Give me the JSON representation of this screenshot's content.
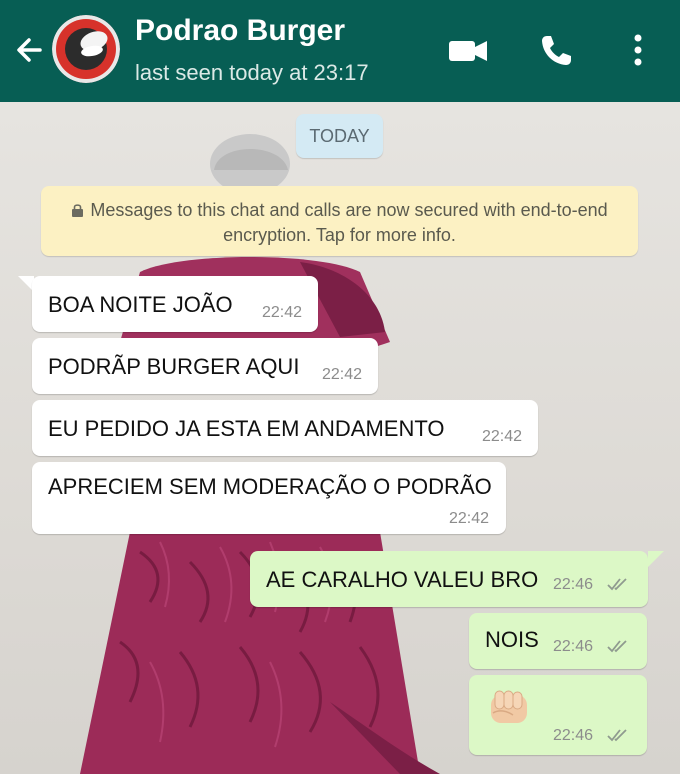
{
  "header": {
    "title": "Podrao Burger",
    "status": "last seen today at 23:17",
    "icons": [
      "back-arrow-icon",
      "avatar",
      "video-call-icon",
      "voice-call-icon",
      "more-options-icon"
    ],
    "bg_color": "#075e54"
  },
  "chat": {
    "date_chip": "TODAY",
    "encryption_notice": "Messages to this chat and calls are now secured with end-to-end encryption. Tap for more info.",
    "messages": [
      {
        "direction": "incoming",
        "text": "BOA NOITE JOÃO",
        "time": "22:42"
      },
      {
        "direction": "incoming",
        "text": "PODRÃP BURGER AQUI",
        "time": "22:42"
      },
      {
        "direction": "incoming",
        "text": "EU PEDIDO JA ESTA EM ANDAMENTO",
        "time": "22:42"
      },
      {
        "direction": "incoming",
        "text": "APRECIEM SEM MODERAÇÃO O PODRÃO",
        "time": "22:42"
      },
      {
        "direction": "outgoing",
        "text": "AE CARALHO VALEU BRO",
        "time": "22:46",
        "status": "read"
      },
      {
        "direction": "outgoing",
        "text": "NOIS",
        "time": "22:46",
        "status": "read"
      },
      {
        "direction": "outgoing",
        "emoji": "oncoming-fist",
        "time": "22:46",
        "status": "read"
      }
    ]
  },
  "colors": {
    "incoming_bubble": "#ffffff",
    "outgoing_bubble": "#dcf8c6",
    "notice_bg": "#fcf1c3",
    "date_chip_bg": "#d4eaf4"
  }
}
